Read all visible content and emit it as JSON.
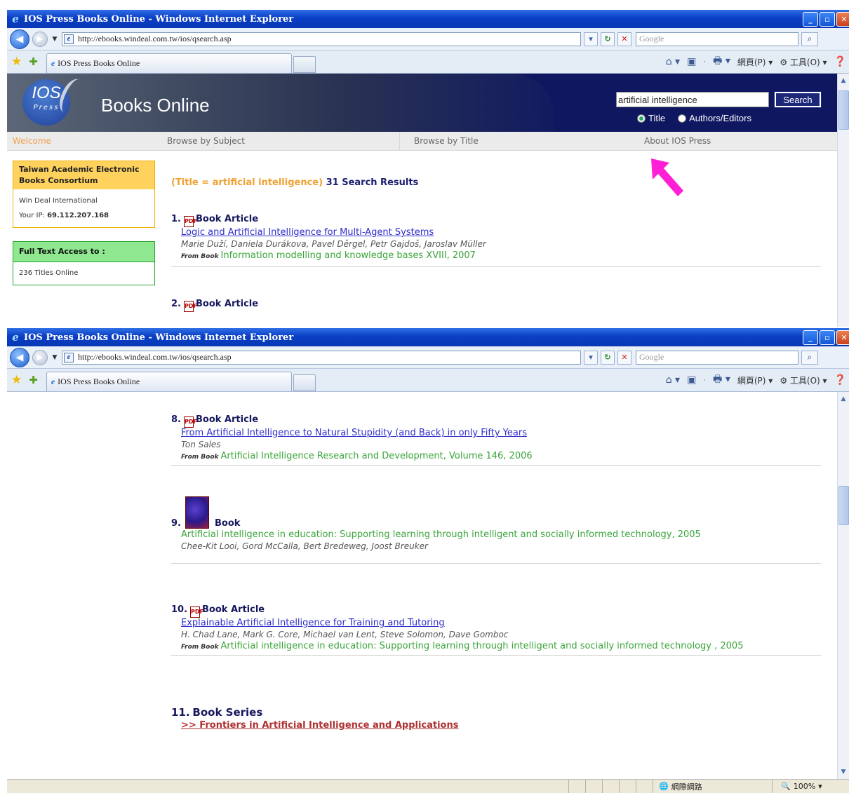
{
  "window": {
    "title": "IOS Press Books Online - Windows Internet Explorer",
    "url": "http://ebooks.windeal.com.tw/ios/qsearch.asp",
    "google_placeholder": "Google",
    "tab_label": "IOS Press Books Online",
    "tools": {
      "page": "網頁(P)",
      "tools": "工具(O)"
    }
  },
  "site": {
    "logo_text": "IOS",
    "logo_sub": "Press",
    "brand": "Books Online",
    "search_value": "artificial intelligence",
    "search_button": "Search",
    "radio_title": "Title",
    "radio_authors": "Authors/Editors",
    "menu": {
      "welcome": "Welcome",
      "subject": "Browse by Subject",
      "title": "Browse by Title",
      "about": "About IOS Press"
    }
  },
  "sidebar": {
    "consortium_title": "Taiwan Academic Electronic Books Consortium",
    "org": "Win Deal International",
    "ip_label": "Your IP:",
    "ip_value": "69.112.207.168",
    "access_title": "Full Text Access to :",
    "access_value": "236 Titles Online"
  },
  "results_header": {
    "query": "(Title = artificial intelligence)",
    "count": "31 Search Results"
  },
  "results_top": [
    {
      "num": "1.",
      "type": "Book Article",
      "title": "Logic and Artificial Intelligence for Multi-Agent Systems",
      "authors": "Marie Duží, Daniela Durákova, Pavel Děrgel, Petr Gajdoš, Jaroslav Müller",
      "from_label": "From Book",
      "from": "Information modelling and knowledge bases XVIII, 2007"
    },
    {
      "num": "2.",
      "type": "Book Article"
    }
  ],
  "results_bottom": [
    {
      "num": "8.",
      "type": "Book Article",
      "title": "From Artificial Intelligence to Natural Stupidity (and Back) in only Fifty Years",
      "authors": "Ton Sales",
      "from_label": "From Book",
      "from": "Artificial Intelligence Research and Development, Volume 146, 2006"
    },
    {
      "num": "9.",
      "type": "Book",
      "book_title": "Artificial intelligence in education: Supporting learning through intelligent and socially informed technology, 2005",
      "authors": "Chee-Kit Looi, Gord McCalla, Bert Bredeweg, Joost Breuker"
    },
    {
      "num": "10.",
      "type": "Book Article",
      "title": "Explainable Artificial Intelligence for Training and Tutoring",
      "authors": "H. Chad Lane, Mark G. Core, Michael van Lent, Steve Solomon, Dave Gomboc",
      "from_label": "From Book",
      "from": "Artificial intelligence in education: Supporting learning through intelligent and socially informed technology , 2005"
    }
  ],
  "series": {
    "num": "11.",
    "type": "Book Series",
    "link": ">> Frontiers in Artificial Intelligence and Applications"
  },
  "statusbar": {
    "zone": "網際網路",
    "zoom": "100%"
  },
  "colors": {
    "annotation_arrow": "#ff1fd6",
    "header_navy": "#0f1760"
  },
  "icons": [
    "ie-icon",
    "back-icon",
    "forward-icon",
    "refresh-icon",
    "stop-icon",
    "search-icon",
    "favorites-star-icon",
    "add-favorite-icon",
    "home-icon",
    "feed-icon",
    "print-icon",
    "page-icon",
    "tools-icon",
    "help-icon",
    "pdf-icon",
    "globe-icon",
    "zoom-icon"
  ]
}
